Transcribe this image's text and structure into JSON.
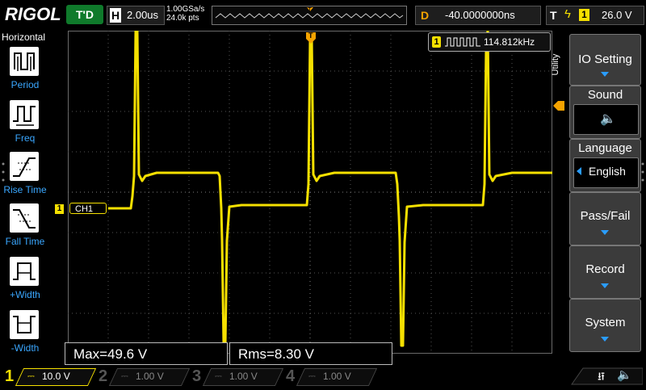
{
  "topbar": {
    "logo": "RIGOL",
    "trigger_status": "T'D",
    "horizontal_label": "H",
    "timebase": "2.00us",
    "sample_rate": "1.00GSa/s",
    "mem_depth": "24.0k pts",
    "memory_marker": "T",
    "delay_label": "D",
    "delay_value": "-40.0000000ns",
    "trigger_label": "T",
    "trigger_source": "1",
    "trigger_level": "26.0 V"
  },
  "left_menu": {
    "title": "Horizontal",
    "items": [
      {
        "label": "Period",
        "icon": "period-icon"
      },
      {
        "label": "Freq",
        "icon": "freq-icon"
      },
      {
        "label": "Rise Time",
        "icon": "rise-time-icon"
      },
      {
        "label": "Fall Time",
        "icon": "fall-time-icon"
      },
      {
        "label": "+Width",
        "icon": "positive-width-icon"
      },
      {
        "label": "-Width",
        "icon": "negative-width-icon"
      }
    ]
  },
  "display": {
    "freq_channel": "1",
    "frequency": "114.812kHz",
    "ch1_marker_num": "1",
    "ch1_tag": "CH1",
    "trigger_pos_marker": "T",
    "measurements": [
      {
        "text": "Max=49.6 V"
      },
      {
        "text": "Rms=8.30 V"
      }
    ]
  },
  "right_menu": {
    "section": "Utility",
    "items": [
      {
        "label": "IO Setting"
      },
      {
        "label": "Sound"
      },
      {
        "label": "Language",
        "value": "English"
      },
      {
        "label": "Pass/Fail"
      },
      {
        "label": "Record"
      },
      {
        "label": "System"
      }
    ]
  },
  "channels": [
    {
      "num": "1",
      "scale": "10.0 V",
      "color": "#f5e000",
      "active": true
    },
    {
      "num": "2",
      "scale": "1.00 V",
      "color": "#00c8ff",
      "active": false
    },
    {
      "num": "3",
      "scale": "1.00 V",
      "color": "#ff40ff",
      "active": false
    },
    {
      "num": "4",
      "scale": "1.00 V",
      "color": "#3a7bff",
      "active": false
    }
  ],
  "colors": {
    "ch1": "#f5e000",
    "accent_blue": "#2a9dff",
    "trigger_orange": "#f5a300"
  }
}
